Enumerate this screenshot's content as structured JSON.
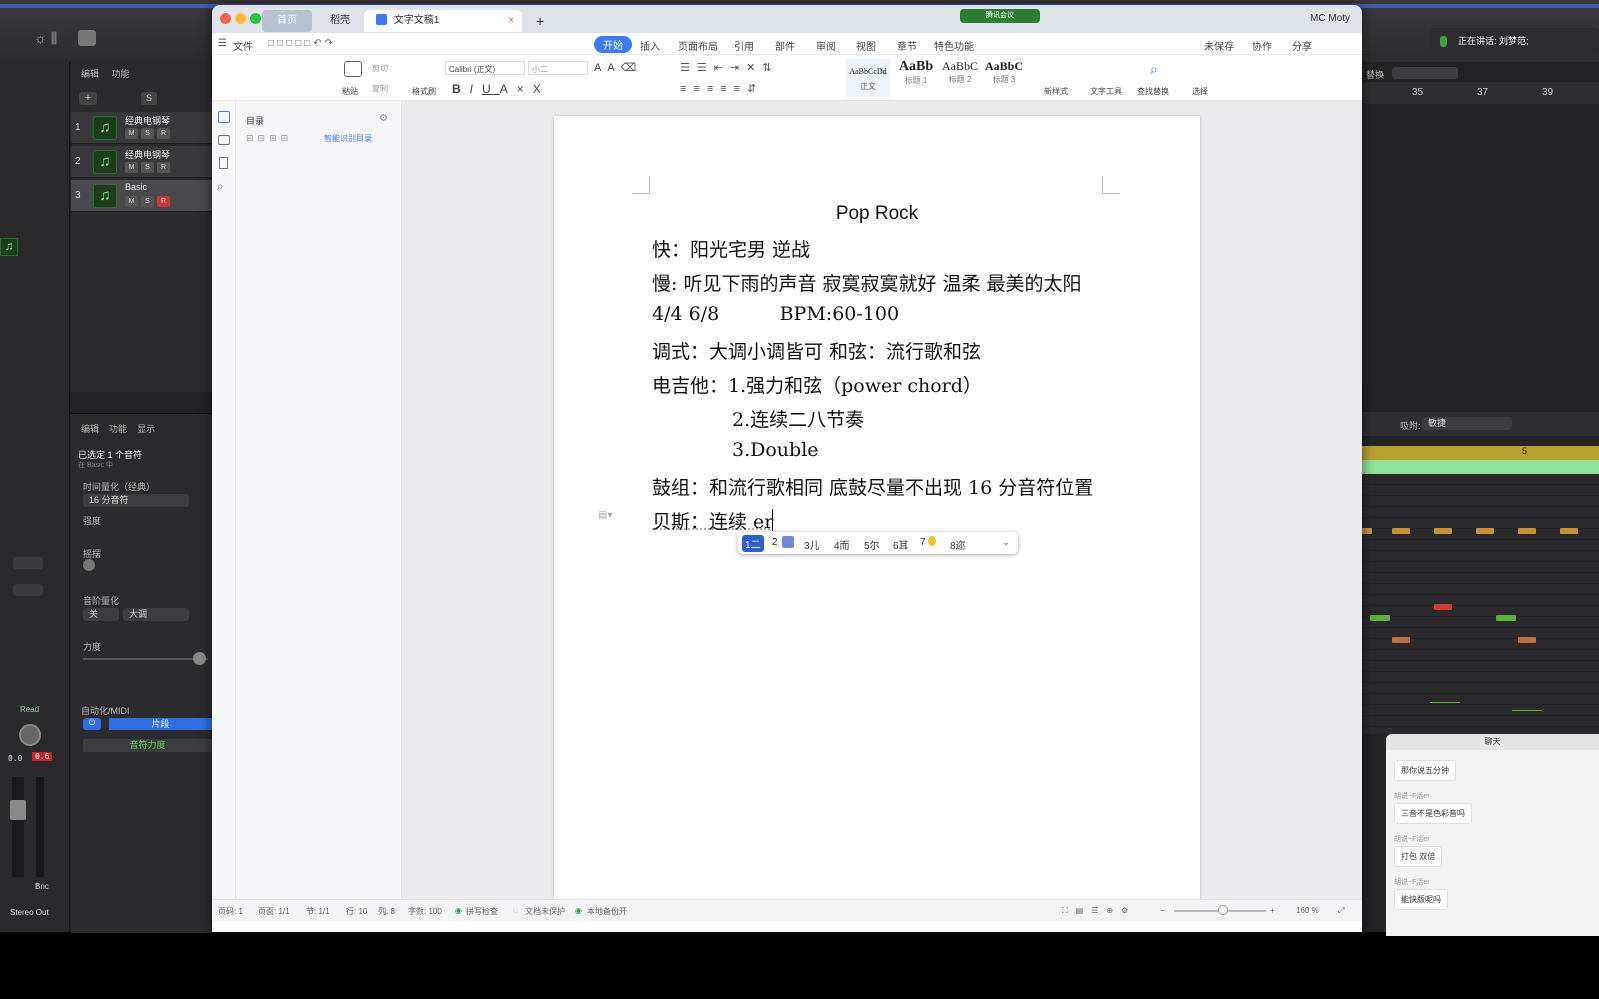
{
  "wps": {
    "tabs": {
      "home": "首页",
      "docer": "稻壳",
      "doc": "文字文稿1",
      "add": "+"
    },
    "user": "MC Moty",
    "meeting_badge": "腾讯会议",
    "file_menu": "文件",
    "menus": [
      "开始",
      "插入",
      "页面布局",
      "引用",
      "审阅",
      "视图",
      "章节",
      "特色功能"
    ],
    "menus_extra": "部件",
    "right_actions": {
      "unsaved": "未保存",
      "collab": "协作",
      "share": "分享"
    },
    "ribbon": {
      "paste": "粘贴",
      "cut": "剪切",
      "copy": "复制",
      "format_painter": "格式刷",
      "font_name": "Calibri (正文)",
      "font_size": "小二",
      "styles": [
        {
          "preview": "AaBbCcDd",
          "caption": "正文"
        },
        {
          "preview": "AaBb",
          "caption": "标题 1"
        },
        {
          "preview": "AaBbC",
          "caption": "标题 2"
        },
        {
          "preview": "AaBbC",
          "caption": "标题 3"
        }
      ],
      "new_style": "新样式",
      "text_tools": "文字工具",
      "find_replace": "查找替换",
      "select": "选择"
    },
    "toc": {
      "title": "目录",
      "smart": "智能识别目录"
    },
    "document": {
      "title": "Pop Rock",
      "lines": [
        "快：阳光宅男  逆战",
        "慢: 听见下雨的声音  寂寞寂寞就好  温柔  最美的太阳",
        "4/4 6/8          BPM:60-100",
        "调式：大调小调皆可    和弦：流行歌和弦",
        "电吉他：1.强力和弦（power chord）",
        "2.连续二八节奏",
        "3.Double",
        "鼓组：和流行歌相同  底鼓尽量不出现 16 分音符位置",
        "贝斯：连续 er"
      ]
    },
    "ime_candidates": [
      "1二",
      "2",
      "3儿",
      "4而",
      "5尔",
      "6耳",
      "7",
      "8迩"
    ],
    "statusbar": {
      "page": "页码: 1",
      "pages": "页面: 1/1",
      "section": "节: 1/1",
      "row": "行: 10",
      "col": "列: 8",
      "words": "字数: 100",
      "spell": "拼写检查",
      "protect": "文档未保护",
      "backup": "本地备份开",
      "zoom": "160 %"
    }
  },
  "logic": {
    "tracks": [
      {
        "num": "1",
        "name": "经典电钢琴"
      },
      {
        "num": "2",
        "name": "经典电钢琴"
      },
      {
        "num": "3",
        "name": "Basic"
      }
    ],
    "track_buttons": [
      "M",
      "S",
      "R"
    ],
    "toolbar_labels": [
      "编辑",
      "功能"
    ],
    "edit_labels": [
      "编辑",
      "功能",
      "显示"
    ],
    "selection": "已选定 1 个音符",
    "selection_sub": "在 Basic 中",
    "time_quant": "时间量化（经典）",
    "quant_value": "16 分音符",
    "strength": "强度",
    "swing": "摇摆",
    "scale_quant": "音阶量化",
    "scale_key": "关",
    "scale_type": "大调",
    "velocity": "力度",
    "automation": "自动化/MIDI",
    "region": "片段",
    "note_velocity": "音符力度",
    "read": "Read",
    "meter_values": [
      "0.0",
      "0.6"
    ],
    "bnc": "Bnc",
    "stereo_out": "Stereo Out",
    "ruler": [
      "35",
      "37",
      "39"
    ],
    "snap_label": "吸附:",
    "snap_value": "敏捷",
    "region_marker": "5",
    "replace_label": "替换",
    "speaking": "正在讲话: 刘梦范;",
    "chat_title": "聊天",
    "chat_messages": [
      {
        "from": "",
        "text": "那你说五分钟"
      },
      {
        "from": "胡说~F活er",
        "text": "三音不是色彩音吗"
      },
      {
        "from": "胡说~F活er",
        "text": "打包 双倍"
      },
      {
        "from": "胡说~F活er",
        "text": "能快版呢吗"
      }
    ]
  }
}
